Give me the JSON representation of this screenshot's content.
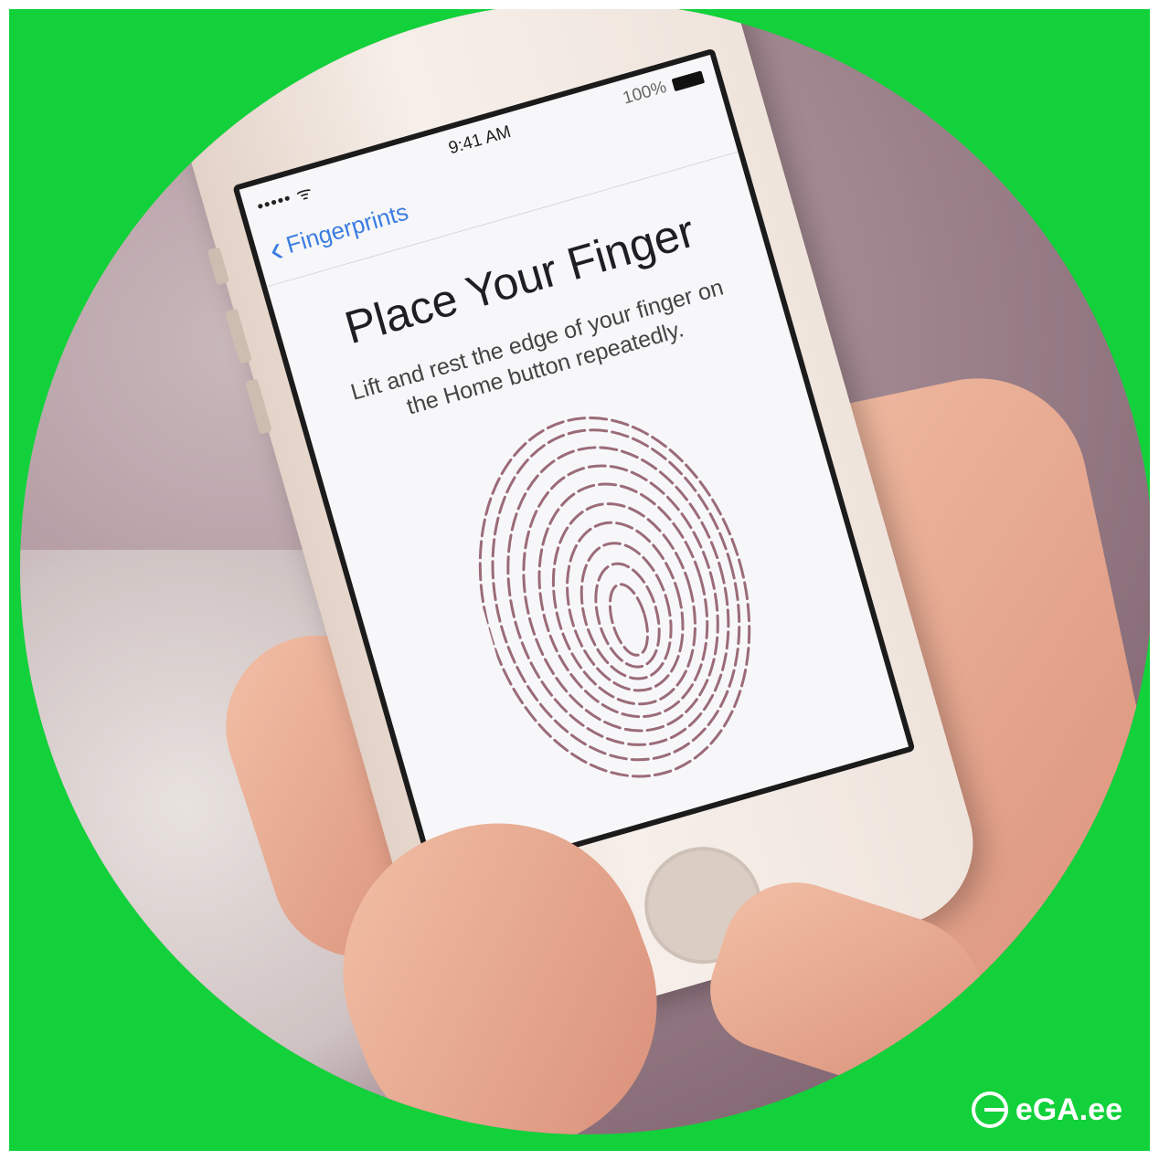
{
  "status_bar": {
    "signal": "••••• ᯤ",
    "time": "9:41 AM",
    "battery": "100%"
  },
  "nav": {
    "back_label": "Fingerprints"
  },
  "screen": {
    "title": "Place Your Finger",
    "instruction": "Lift and rest the edge of your finger on the Home button repeatedly."
  },
  "logo": {
    "text": "eGA.ee"
  },
  "colors": {
    "frame": "#12d13a",
    "link": "#3b7de0",
    "fingerprint": "#9b6b78"
  },
  "icons": {
    "back": "chevron-left-icon",
    "battery": "battery-icon",
    "wifi": "wifi-icon",
    "fingerprint": "fingerprint-icon"
  }
}
